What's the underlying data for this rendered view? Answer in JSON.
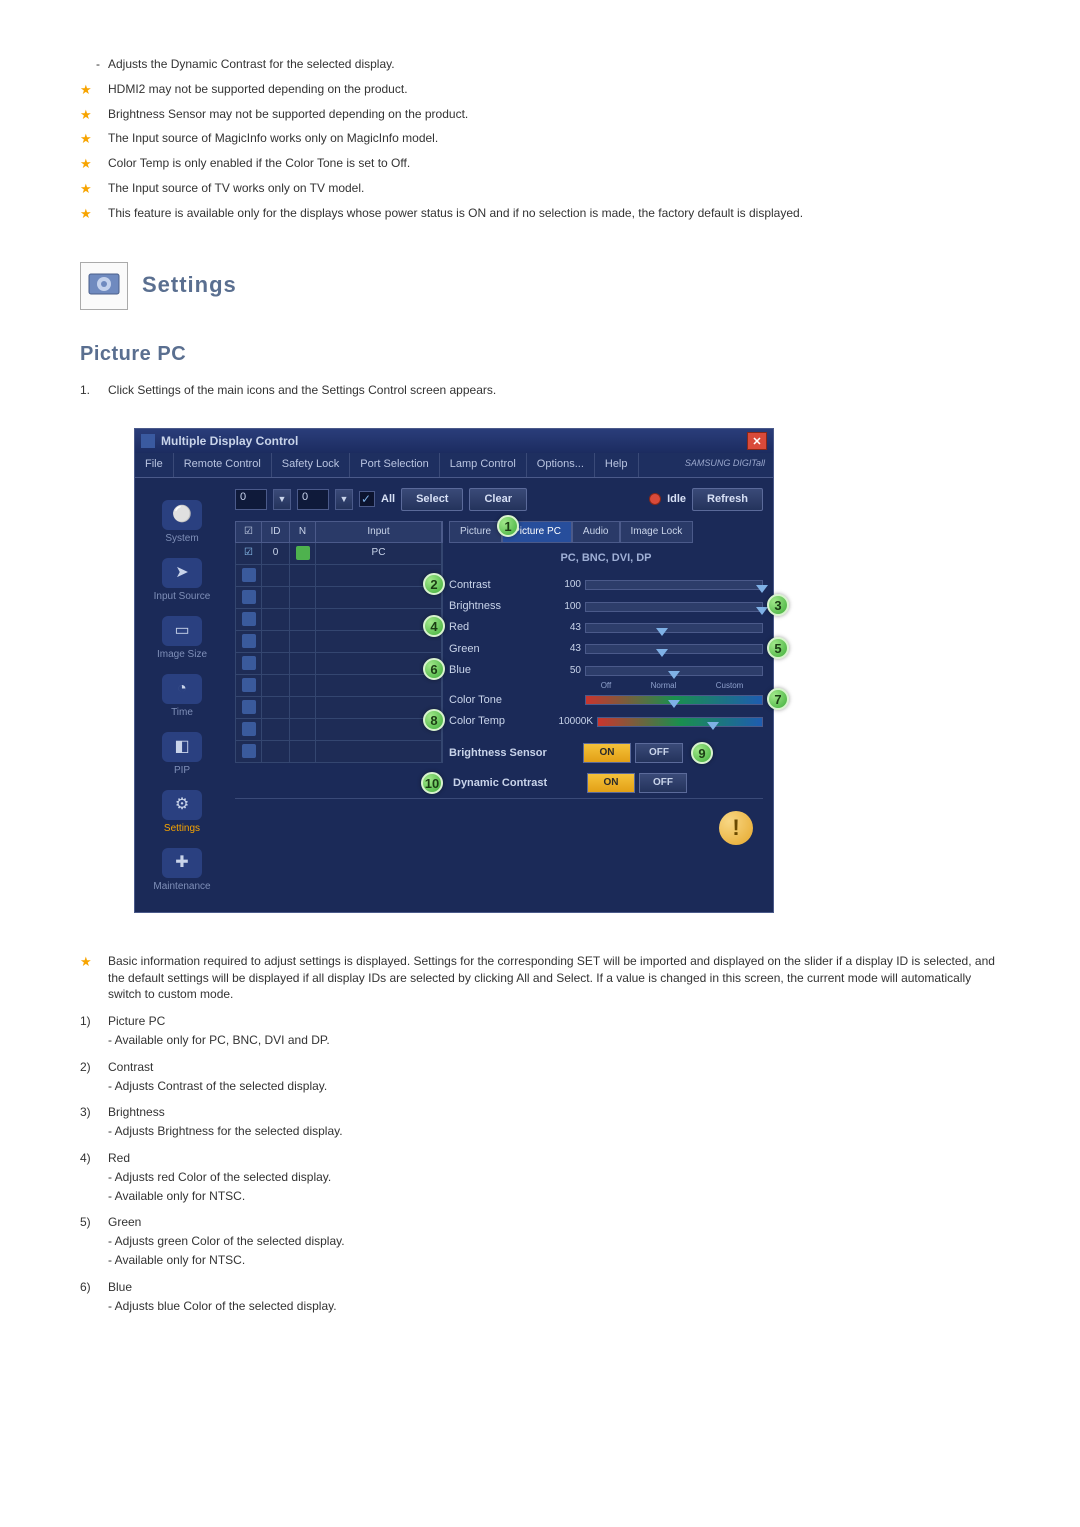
{
  "top_notes": {
    "sub": "Adjusts the Dynamic Contrast for the selected display.",
    "n1": "HDMI2 may not be supported depending on the product.",
    "n2": "Brightness Sensor may not be supported depending on the product.",
    "n3": "The Input source of MagicInfo works only on MagicInfo model.",
    "n4": "Color Temp is only enabled if the Color Tone is set to Off.",
    "n5": "The Input source of TV works only on TV model.",
    "n6": "This feature is available only for the displays whose power status is ON and if no selection is made, the factory default is displayed."
  },
  "section_title": "Settings",
  "subsection_title": "Picture PC",
  "step": {
    "num": "1.",
    "text": "Click Settings of the main icons and the Settings Control screen appears."
  },
  "app": {
    "title": "Multiple Display Control",
    "menu": {
      "file": "File",
      "remote": "Remote Control",
      "safety": "Safety Lock",
      "port": "Port Selection",
      "lamp": "Lamp Control",
      "options": "Options...",
      "help": "Help"
    },
    "brand": "SAMSUNG DIGITall",
    "toolbar": {
      "v1": "0",
      "v2": "0",
      "all": "All",
      "select": "Select",
      "clear": "Clear",
      "idle": "Idle",
      "refresh": "Refresh"
    },
    "sidebar": {
      "system": "System",
      "input": "Input Source",
      "image": "Image Size",
      "time": "Time",
      "pip": "PIP",
      "settings": "Settings",
      "maint": "Maintenance"
    },
    "table": {
      "th_id": "ID",
      "th_n": "N",
      "th_input": "Input",
      "r1_id": "0",
      "r1_n": "O",
      "r1_input": "PC"
    },
    "tabs": {
      "picture": "Picture",
      "picture_pc": "Picture PC",
      "audio": "Audio",
      "image_lock": "Image Lock"
    },
    "panel": {
      "note": "PC, BNC, DVI, DP",
      "contrast": "Contrast",
      "contrast_v": "100",
      "brightness": "Brightness",
      "brightness_v": "100",
      "red": "Red",
      "red_v": "43",
      "green": "Green",
      "green_v": "43",
      "blue": "Blue",
      "blue_v": "50",
      "color_tone": "Color Tone",
      "tone_off": "Off",
      "tone_normal": "Normal",
      "tone_custom": "Custom",
      "color_temp": "Color Temp",
      "color_temp_v": "10000K",
      "bright_sensor": "Brightness Sensor",
      "dyn_contrast": "Dynamic Contrast",
      "on": "ON",
      "off": "OFF"
    },
    "callouts": {
      "c1": "1",
      "c2": "2",
      "c3": "3",
      "c4": "4",
      "c5": "5",
      "c6": "6",
      "c7": "7",
      "c8": "8",
      "c9": "9",
      "c10": "10"
    }
  },
  "bottom": {
    "star": "Basic information required to adjust settings is displayed. Settings for the corresponding SET will be imported and displayed on the slider if a display ID is selected, and the default settings will be displayed if all display IDs are selected by clicking All and Select. If a value is changed in this screen, the current mode will automatically switch to custom mode.",
    "i1_num": "1)",
    "i1_t": "Picture PC",
    "i1_s1": "Available only for PC, BNC, DVI and DP.",
    "i2_num": "2)",
    "i2_t": "Contrast",
    "i2_s1": "Adjusts Contrast of the selected display.",
    "i3_num": "3)",
    "i3_t": "Brightness",
    "i3_s1": "Adjusts Brightness for the selected display.",
    "i4_num": "4)",
    "i4_t": "Red",
    "i4_s1": "Adjusts red Color of the selected display.",
    "i4_s2": "Available only for NTSC.",
    "i5_num": "5)",
    "i5_t": "Green",
    "i5_s1": "Adjusts green Color of the selected display.",
    "i5_s2": "Available only for NTSC.",
    "i6_num": "6)",
    "i6_t": "Blue",
    "i6_s1": "Adjusts blue Color of the selected display."
  }
}
